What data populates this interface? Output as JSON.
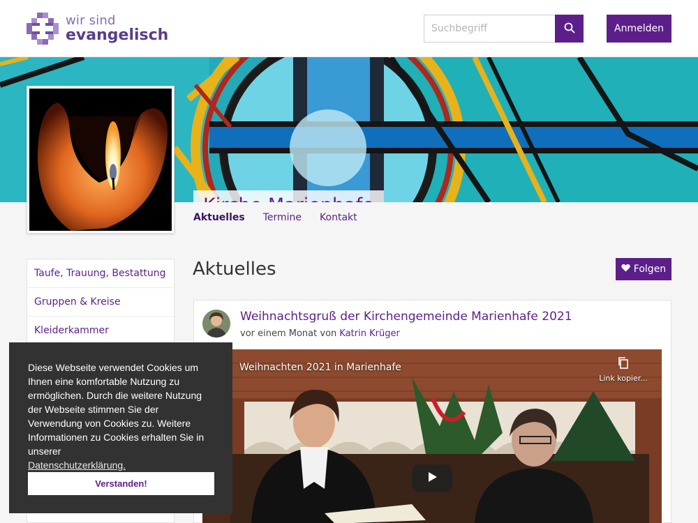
{
  "header": {
    "logo_line1": "wir sind",
    "logo_line2": "evangelisch",
    "search_placeholder": "Suchbegriff",
    "search_icon": "search-icon",
    "login_label": "Anmelden"
  },
  "banner": {
    "title": "Kirche Marienhafe"
  },
  "tabs": [
    {
      "label": "Aktuelles",
      "active": true
    },
    {
      "label": "Termine",
      "active": false
    },
    {
      "label": "Kontakt",
      "active": false
    }
  ],
  "sidebar": {
    "items": [
      {
        "label": "Taufe, Trauung, Bestattung"
      },
      {
        "label": "Gruppen & Kreise"
      },
      {
        "label": "Kleiderkammer"
      }
    ]
  },
  "main": {
    "section_title": "Aktuelles",
    "follow_label": "Folgen",
    "follow_icon": "heart-icon"
  },
  "post": {
    "title": "Weihnachtsgruß der Kirchengemeinde Marienhafe 2021",
    "meta_prefix": "vor einem Monat von",
    "author": "Katrin Krüger",
    "video_title": "Weihnachten 2021 in Marienhafe",
    "copy_link_label": "Link kopier..."
  },
  "cookie": {
    "text": "Diese Webseite verwendet Cookies um Ihnen eine komfortable Nutzung zu ermöglichen. Durch die weitere Nutzung der Webseite stimmen Sie der Verwendung von Cookies zu. Weitere Informationen zu Cookies erhalten Sie in unserer",
    "link": "Datenschutzerklärung.",
    "button": "Verstanden!"
  },
  "colors": {
    "brand": "#5c1f8a",
    "cookie_bg": "#323232"
  }
}
